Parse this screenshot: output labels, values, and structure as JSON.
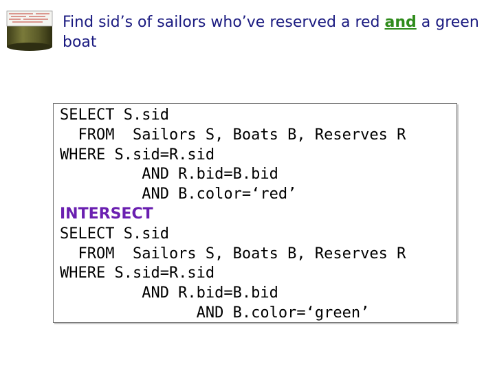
{
  "slide": {
    "title_parts": {
      "before": "Find sid’s of sailors who’ve reserved a red ",
      "highlight": "and",
      "after": " a green boat"
    },
    "logo": {
      "icon": "database-cylinder-icon",
      "color": "#5a5a2a"
    }
  },
  "query": {
    "lines": [
      "SELECT S.sid",
      "  FROM  Sailors S, Boats B, Reserves R",
      "WHERE S.sid=R.sid",
      "         AND R.bid=B.bid",
      "         AND B.color=‘red’",
      "INTERSECT",
      "SELECT S.sid",
      "  FROM  Sailors S, Boats B, Reserves R",
      "WHERE S.sid=R.sid",
      "         AND R.bid=B.bid",
      "               AND B.color=‘green’"
    ],
    "keyword_color": "#6a1fb0"
  }
}
